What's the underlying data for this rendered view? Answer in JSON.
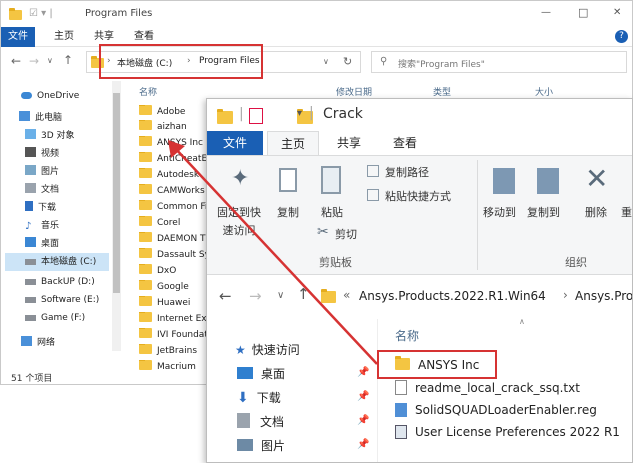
{
  "back_window": {
    "title": "Program Files",
    "tabs": [
      "文件",
      "主页",
      "共享",
      "查看"
    ],
    "breadcrumb": [
      "本地磁盘 (C:)",
      "Program Files"
    ],
    "search_placeholder": "搜索\"Program Files\"",
    "columns": [
      "名称",
      "修改日期",
      "类型",
      "大小"
    ],
    "nav_items": [
      "OneDrive",
      "此电脑",
      "3D 对象",
      "视频",
      "图片",
      "文档",
      "下载",
      "音乐",
      "桌面",
      "本地磁盘 (C:)",
      "BackUP (D:)",
      "Software (E:)",
      "Game (F:)",
      "网络"
    ],
    "files": [
      "Adobe",
      "aizhan",
      "ANSYS Inc",
      "AntiCheatEx",
      "Autodesk",
      "CAMWorks",
      "Common Fil",
      "Corel",
      "DAEMON T",
      "Dassault Sys",
      "DxO",
      "Google",
      "Huawei",
      "Internet Exp",
      "IVI Foundati",
      "JetBrains",
      "Macrium"
    ],
    "status": "51 个项目",
    "window_controls": [
      "—",
      "□",
      "✕"
    ]
  },
  "front_window": {
    "title": "Crack",
    "tabs": [
      "文件",
      "主页",
      "共享",
      "查看"
    ],
    "ribbon": {
      "pin": "固定到快\n速访问",
      "copy": "复制",
      "paste": "粘贴",
      "copy_path": "复制路径",
      "paste_shortcut": "粘贴快捷方式",
      "cut": "剪切",
      "clipboard_group": "剪贴板",
      "move_to": "移动到",
      "copy_to": "复制到",
      "delete": "删除",
      "rename_partial": "重",
      "organize_group": "组织"
    },
    "breadcrumb": [
      "Ansys.Products.2022.R1.Win64",
      "Ansys.Pro"
    ],
    "column_name": "名称",
    "nav_items": [
      "快速访问",
      "桌面",
      "下载",
      "文档",
      "图片"
    ],
    "files": [
      "ANSYS Inc",
      "readme_local_crack_ssq.txt",
      "SolidSQUADLoaderEnabler.reg",
      "User License Preferences 2022 R1"
    ]
  },
  "colors": {
    "accent": "#1a5fb4",
    "folder": "#f4c542",
    "highlight": "#d63333"
  }
}
